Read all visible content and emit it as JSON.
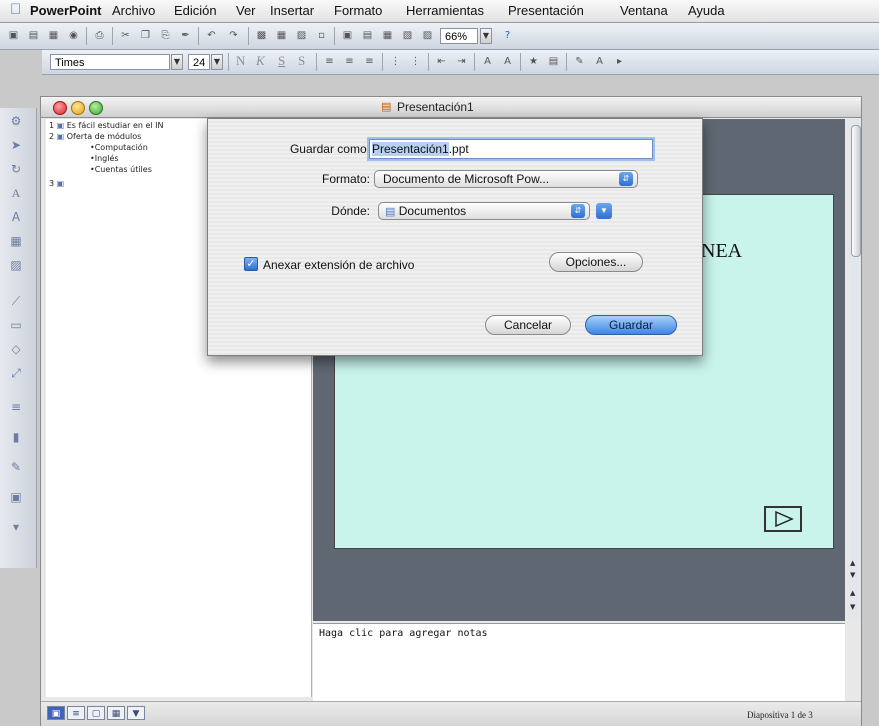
{
  "menubar": {
    "app": "PowerPoint",
    "items": [
      "Archivo",
      "Edición",
      "Ver",
      "Insertar",
      "Formato",
      "Herramientas",
      "Presentación",
      "Ventana",
      "Ayuda"
    ]
  },
  "toolbar": {
    "zoom": "66%"
  },
  "format_toolbar": {
    "font": "Times",
    "size": "24",
    "bold": "N",
    "italic": "K",
    "underline": "S",
    "shadow": "S"
  },
  "window": {
    "title": "Presentación1"
  },
  "outline": {
    "items": [
      {
        "num": "1",
        "text": "Es fácil estudiar en el IN"
      },
      {
        "num": "2",
        "text": "Oferta de módulos"
      },
      {
        "num": "",
        "text": "•Computación"
      },
      {
        "num": "",
        "text": "•Inglés"
      },
      {
        "num": "",
        "text": "•Cuentas útiles"
      },
      {
        "num": "3",
        "text": ""
      }
    ]
  },
  "slide": {
    "visible_text": "NEA"
  },
  "notes": {
    "placeholder": "Haga clic para agregar notas"
  },
  "status": {
    "text": "Diapositiva 1 de 3"
  },
  "dialog": {
    "save_as_label": "Guardar como:",
    "filename_selected": "Presentación1",
    "filename_ext": ".ppt",
    "format_label": "Formato:",
    "format_value": "Documento de Microsoft Pow...",
    "where_label": "Dónde:",
    "where_value": "Documentos",
    "append_ext_label": "Anexar extensión de archivo",
    "append_ext_checked": true,
    "options_button": "Opciones...",
    "cancel_button": "Cancelar",
    "save_button": "Guardar"
  }
}
